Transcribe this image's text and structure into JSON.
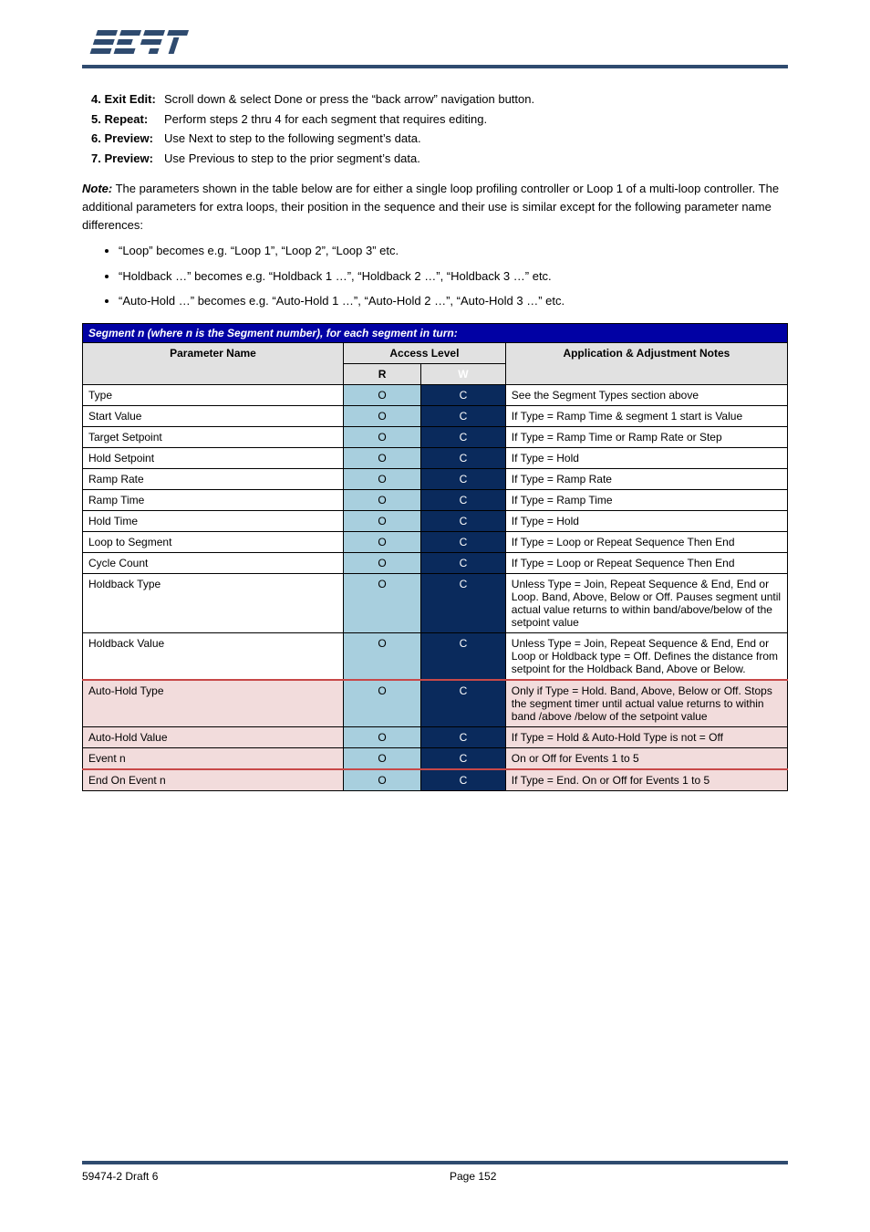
{
  "brand": "WEST",
  "intro": [
    {
      "n": "4.",
      "label": "Exit Edit:",
      "text": "Scroll down & select Done or press the “back arrow” navigation button."
    },
    {
      "n": "5.",
      "label": "Repeat:",
      "text": "Perform steps 2 thru 4 for each segment that requires editing."
    },
    {
      "n": "6.",
      "label": "Preview:",
      "text": "Use Next to step to the following segment’s data."
    },
    {
      "n": "7.",
      "label": "Preview:",
      "text": "Use Previous to step to the prior segment’s data."
    }
  ],
  "note_label": "Note:",
  "note_body": "The parameters shown in the table below are for either a single loop profiling controller or Loop 1 of a multi-loop controller. The additional parameters for extra loops, their position in the sequence and their use is similar except for the following parameter name differences:",
  "bullets": [
    "“Loop” becomes e.g. “Loop 1”, “Loop 2”, “Loop 3” etc.",
    "“Holdback …” becomes e.g. “Holdback 1 …”, “Holdback 2 …”, “Holdback 3 …” etc.",
    "“Auto-Hold …” becomes e.g. “Auto-Hold 1 …”, “Auto-Hold 2 …”, “Auto-Hold 3 …” etc."
  ],
  "table_title": "Segment n (where n is the Segment number), for each segment in turn:",
  "col_param": "Parameter Name",
  "col_access": "Access Level",
  "col_r": "R",
  "col_w": "W",
  "col_notes": "Application & Adjustment Notes",
  "rows": [
    {
      "param": "Type",
      "r": "O",
      "w": "C",
      "notes": "See the Segment Types section above"
    },
    {
      "param": "Start Value",
      "r": "O",
      "w": "C",
      "notes": "If Type = Ramp Time & segment 1 start is Value"
    },
    {
      "param": "Target Setpoint",
      "r": "O",
      "w": "C",
      "notes": "If Type = Ramp Time or Ramp Rate or Step"
    },
    {
      "param": "Hold Setpoint",
      "r": "O",
      "w": "C",
      "notes": "If Type = Hold"
    },
    {
      "param": "Ramp Rate",
      "r": "O",
      "w": "C",
      "notes": "If Type = Ramp Rate"
    },
    {
      "param": "Ramp Time",
      "r": "O",
      "w": "C",
      "notes": "If Type = Ramp Time"
    },
    {
      "param": "Hold Time",
      "r": "O",
      "w": "C",
      "notes": "If Type = Hold"
    },
    {
      "param": "Loop to Segment",
      "r": "O",
      "w": "C",
      "notes": "If Type = Loop or Repeat Sequence Then End"
    },
    {
      "param": "Cycle Count",
      "r": "O",
      "w": "C",
      "notes": "If Type = Loop or Repeat Sequence Then End"
    },
    {
      "param": "Holdback Type",
      "r": "O",
      "w": "C",
      "notes": "Unless Type = Join, Repeat Sequence & End, End or Loop. Band, Above, Below or Off. Pauses segment until actual value returns to within band/above/below of the setpoint value"
    },
    {
      "param": "Holdback Value",
      "r": "O",
      "w": "C",
      "notes": "Unless Type = Join, Repeat Sequence & End, End or Loop or Holdback type = Off. Defines the distance from setpoint for the Holdback Band, Above or Below."
    },
    {
      "param": "Auto-Hold Type",
      "r": "O",
      "w": "C",
      "notes": "Only if Type = Hold. Band, Above, Below or Off. Stops the segment timer until actual value returns to within band /above /below of the setpoint value",
      "pink": true,
      "topRed": true
    },
    {
      "param": "Auto-Hold Value",
      "r": "O",
      "w": "C",
      "notes": "If Type = Hold & Auto-Hold Type is not = Off",
      "pink": true
    },
    {
      "param": "Event n",
      "r": "O",
      "w": "C",
      "notes": "On or Off for Events 1 to 5",
      "pink": true,
      "botRed": true
    },
    {
      "param": "End On Event n",
      "r": "O",
      "w": "C",
      "notes": "If Type = End. On or Off for Events 1 to 5",
      "pink": true
    }
  ],
  "footer_left": "59474-2 Draft 6",
  "footer_center": "Page 152",
  "footer_right": ""
}
